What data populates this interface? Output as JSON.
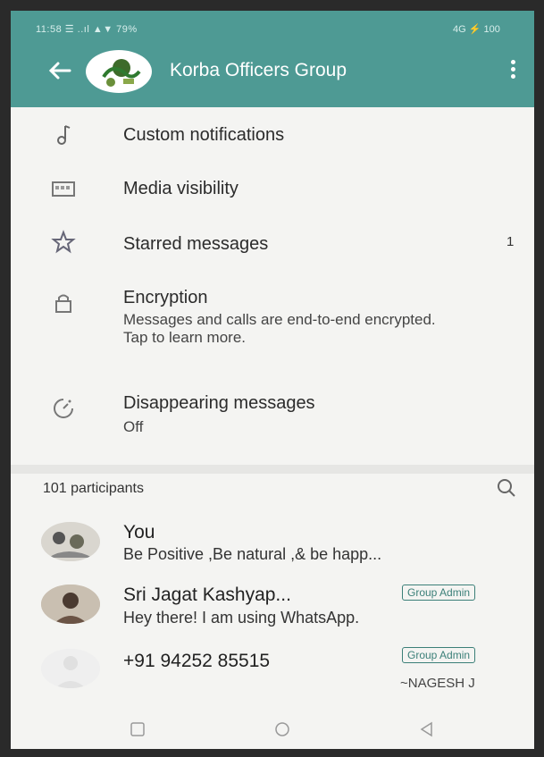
{
  "status_bar": {
    "left": "11:58 ☰ ..ıl ▲▼ 79%",
    "right": "4G ⚡ 100"
  },
  "header": {
    "title": "Korba Officers Group"
  },
  "settings": [
    {
      "key": "custom",
      "title": "Custom notifications",
      "icon": "music-note-icon"
    },
    {
      "key": "media",
      "title": "Media visibility",
      "icon": "image-gallery-icon"
    },
    {
      "key": "starred",
      "title": "Starred messages",
      "icon": "star-icon",
      "count": "1"
    },
    {
      "key": "encryption",
      "title": "Encryption",
      "subtitle": "Messages and calls are end-to-end encrypted. Tap to learn more.",
      "icon": "lock-icon"
    },
    {
      "key": "disappearing",
      "title": "Disappearing messages",
      "subtitle": "Off",
      "icon": "timer-icon"
    }
  ],
  "participants": {
    "label": "101 participants",
    "list": [
      {
        "name": "You",
        "status": "Be Positive ,Be natural ,& be happ..."
      },
      {
        "name": "Sri Jagat Kashyap...",
        "status": "Hey there! I am using WhatsApp.",
        "badge": "Group Admin"
      },
      {
        "name": "+91 94252 85515",
        "badge": "Group Admin",
        "extra": "~NAGESH J"
      }
    ]
  },
  "colors": {
    "header": "#4e9a94",
    "accent": "#3b7f78",
    "background": "#f4f4f2"
  }
}
